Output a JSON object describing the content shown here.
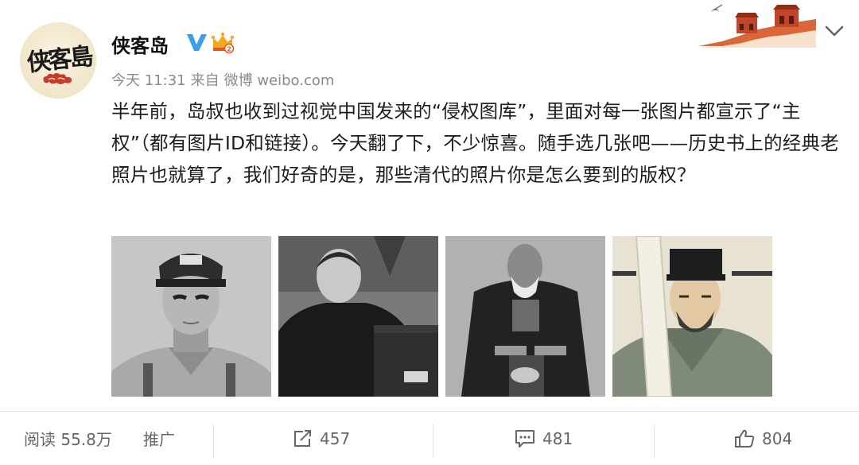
{
  "post": {
    "author": "侠客岛",
    "avatar_text": "侠客島",
    "meta": {
      "time": "今天 11:31",
      "source_prefix": "来自",
      "source": "微博 weibo.com"
    },
    "text": "半年前，岛叔也收到过视觉中国发来的“侵权图库”，里面对每一张图片都宣示了“主权”（都有图片ID和链接）。今天翻了下，不少惊喜。随手选几张吧——历史书上的经典老照片也就算了，我们好奇的是，那些清代的照片你是怎么要到的版权？",
    "photos": [
      {
        "name": "photo-military-portrait"
      },
      {
        "name": "photo-speaker-at-podium"
      },
      {
        "name": "photo-qing-official-seated"
      },
      {
        "name": "photo-ancient-painted-portrait"
      }
    ]
  },
  "footer": {
    "reads": "阅读 55.8万",
    "promote": "推广",
    "reposts": "457",
    "comments": "481",
    "likes": "804"
  },
  "icons": {
    "verified": "verified-v-icon",
    "crown": "vip-crown-icon",
    "chevron": "chevron-down-icon",
    "repost": "repost-icon",
    "comment": "comment-icon",
    "like": "thumbs-up-icon"
  },
  "colors": {
    "verified_blue": "#3d9ee8",
    "crown_orange": "#f5a623",
    "meta_gray": "#8a8a8a"
  }
}
